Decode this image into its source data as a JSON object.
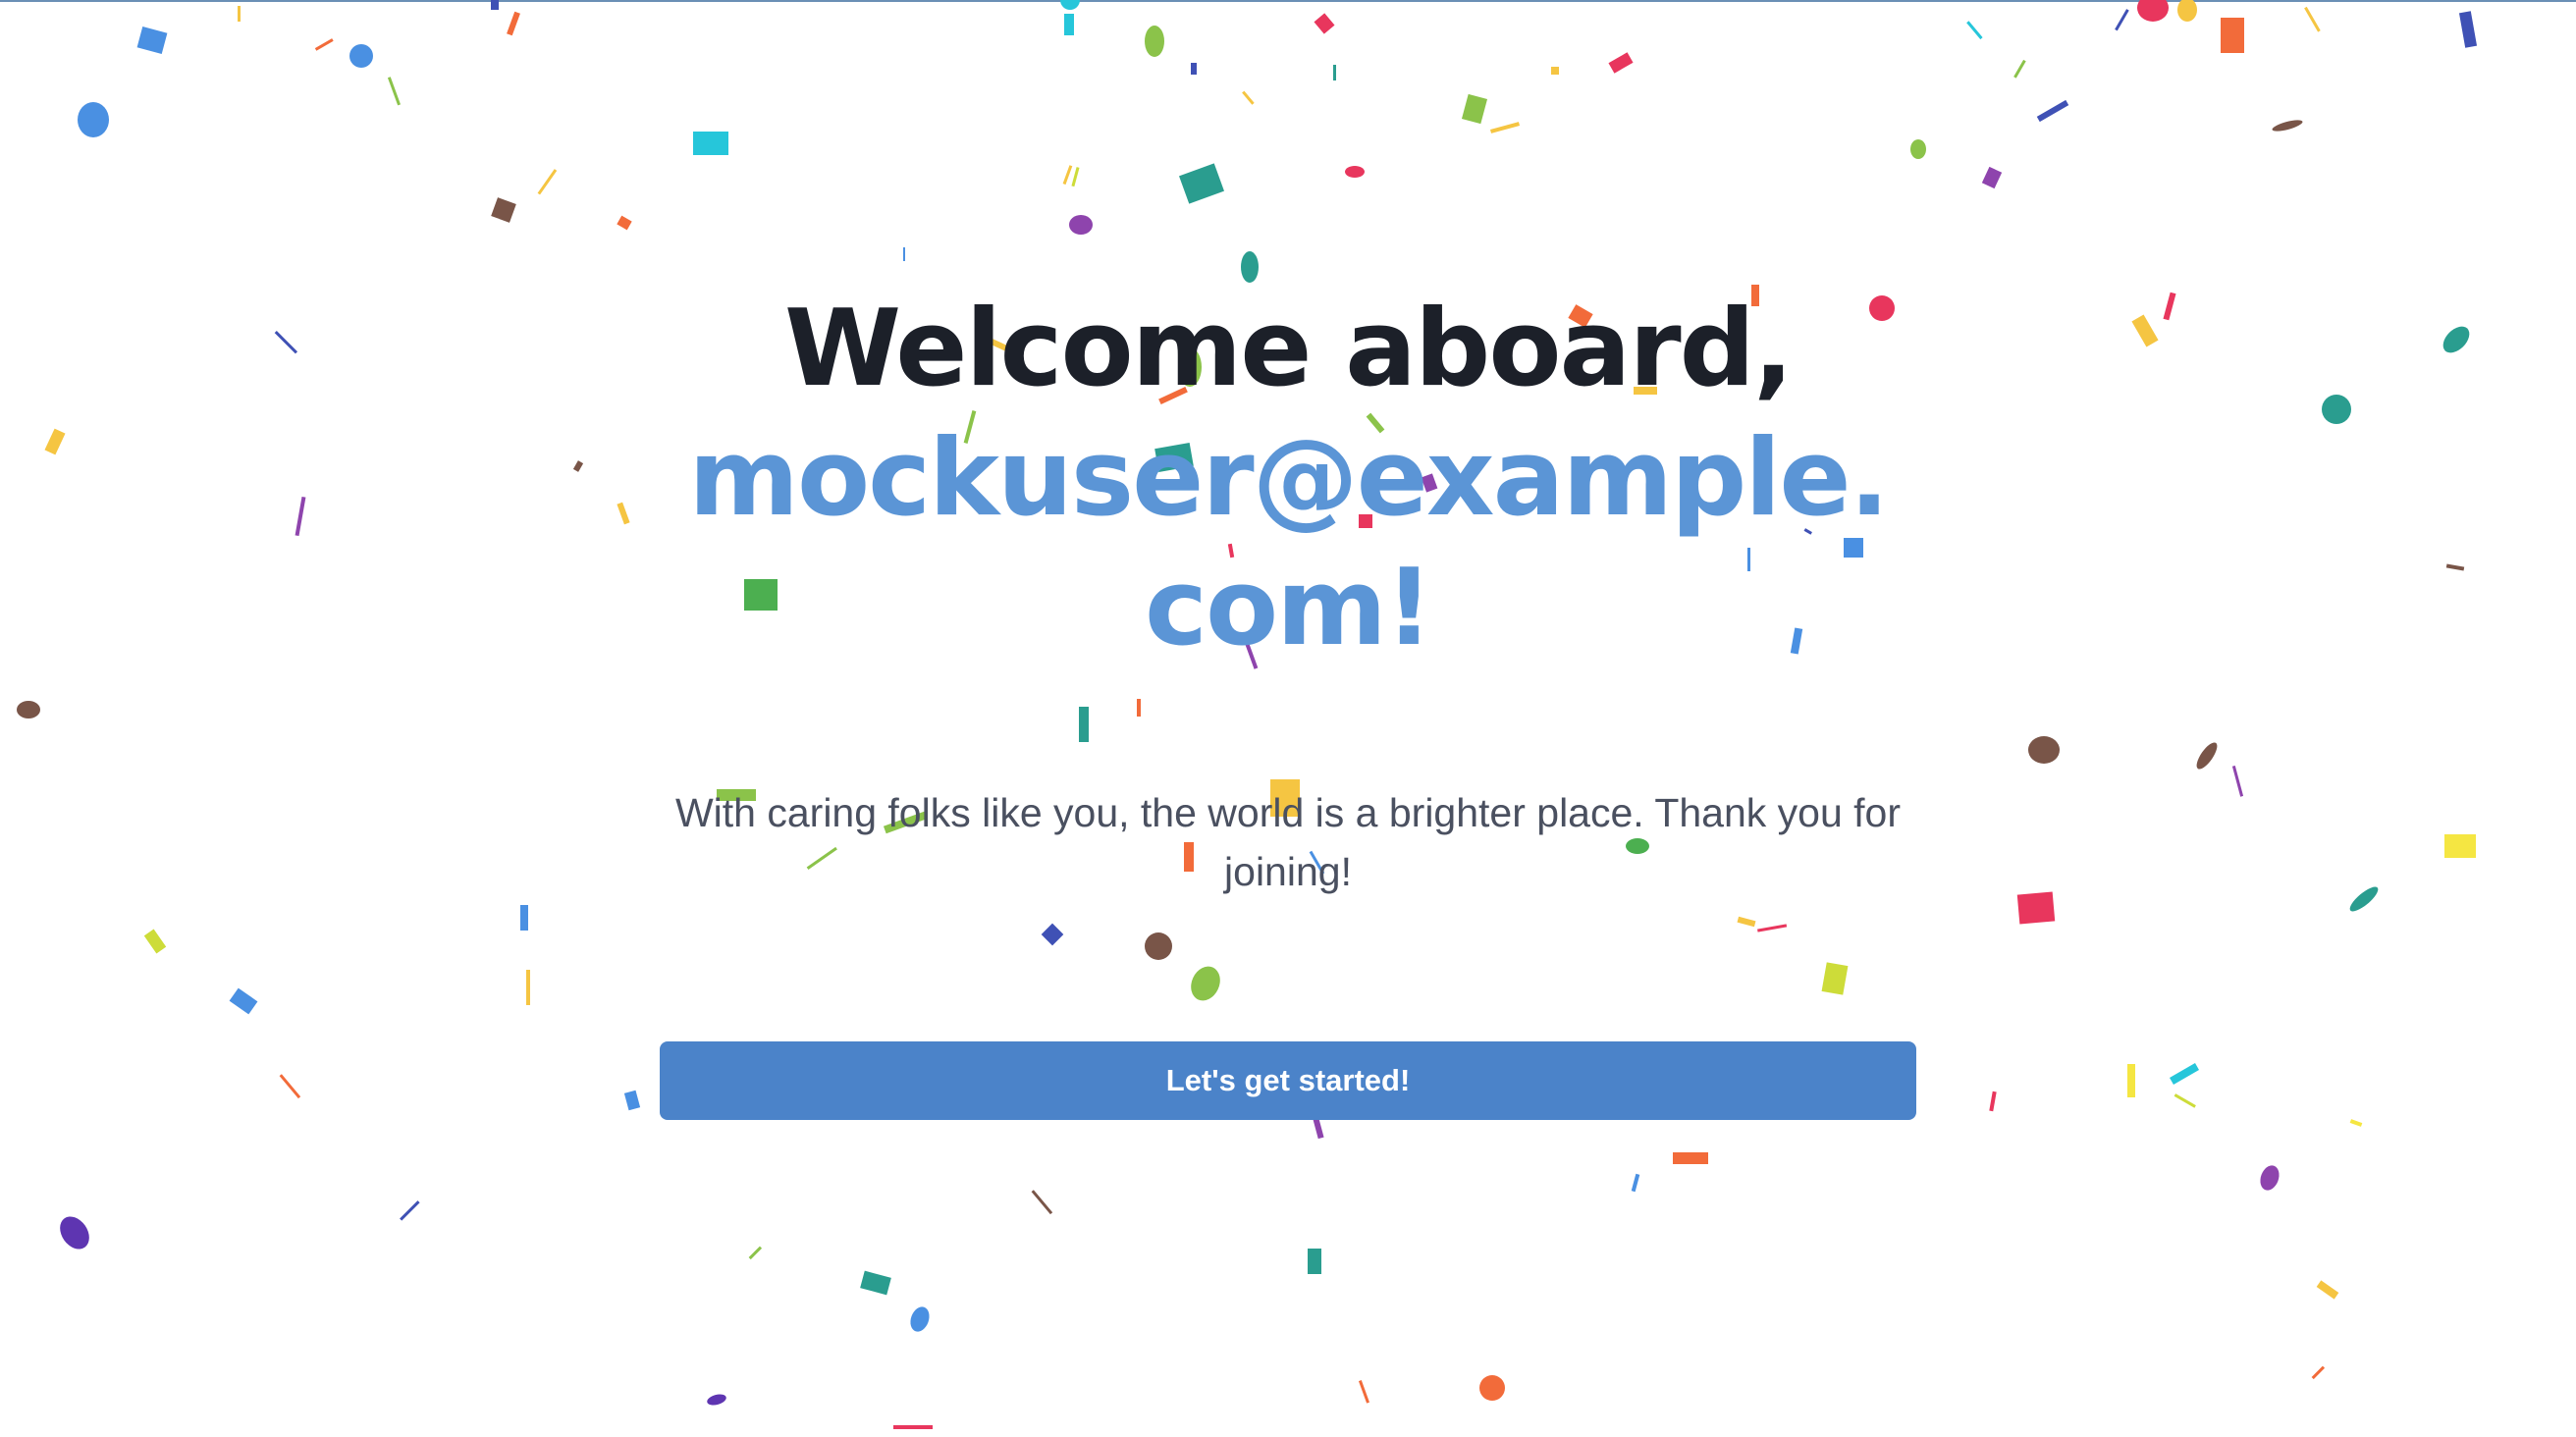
{
  "welcome": {
    "greeting": "Welcome aboard,",
    "email": "mockuser@example.com!",
    "subtitle": "With caring folks like you, the world is a brighter place. Thank you for joining!"
  },
  "cta": {
    "label": "Let's get started!"
  },
  "colors": {
    "heading": "#1c2029",
    "email": "#5b95d6",
    "button": "#4b83c9",
    "confetti": [
      "#e8365d",
      "#f5c542",
      "#4a90e2",
      "#2a9d8f",
      "#8e44ad",
      "#f26b3a",
      "#8bc34a",
      "#795548",
      "#26c6da",
      "#3f51b5"
    ]
  }
}
